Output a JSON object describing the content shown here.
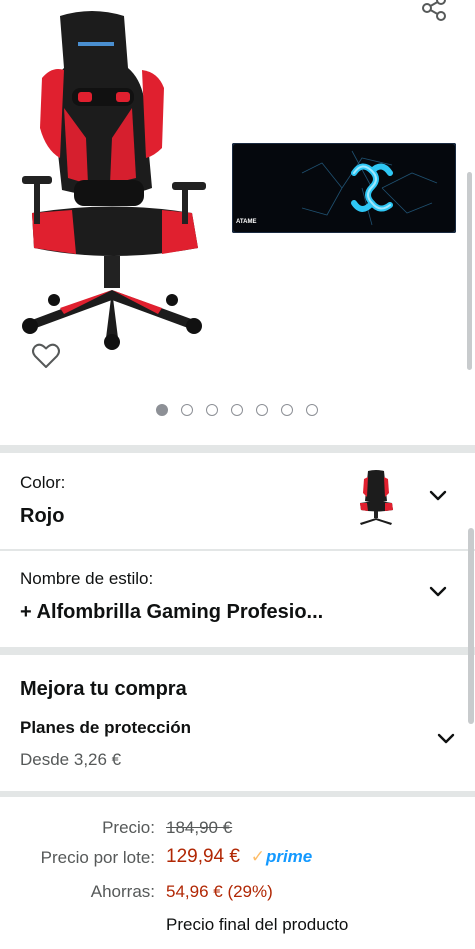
{
  "gallery": {
    "share_icon": "share-icon",
    "wishlist_icon": "heart-outline-icon",
    "dots_total": 7,
    "active_dot": 0,
    "mousepad_logo_text": "ATAME"
  },
  "color_selector": {
    "label": "Color:",
    "value": "Rojo",
    "icon": "chevron-down-icon"
  },
  "style_selector": {
    "label": "Nombre de estilo:",
    "value": "+ Alfombrilla Gaming Profesio...",
    "icon": "chevron-down-icon"
  },
  "upgrade": {
    "title": "Mejora tu compra",
    "plan_title": "Planes de protección",
    "plan_from": "Desde 3,26 €",
    "icon": "chevron-down-icon"
  },
  "pricing": {
    "list_label": "Precio:",
    "list_price": "184,90 €",
    "deal_label": "Precio por lote:",
    "deal_price": "129,94 €",
    "prime_badge": "prime",
    "savings_label": "Ahorras:",
    "savings_value": "54,96 € (29%)",
    "final_note": "Precio final del producto"
  },
  "colors": {
    "deal_price": "#B12704",
    "prime_blue": "#1399FF",
    "prime_check": "#FEBD69",
    "chair_red": "#E0202F",
    "mousepad_glow": "#2EC7F5",
    "separator": "#E3E6E6"
  }
}
